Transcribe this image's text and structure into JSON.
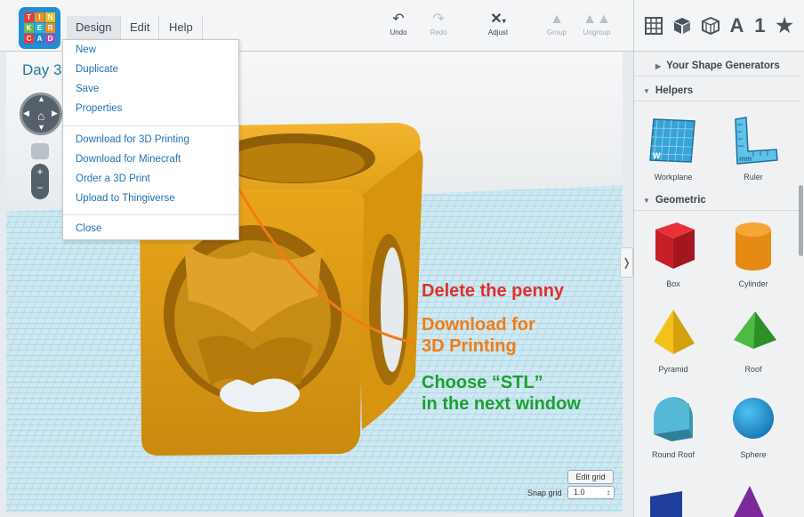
{
  "app": {
    "logo_letters": [
      "T",
      "I",
      "N",
      "K",
      "E",
      "R",
      "C",
      "A",
      "D"
    ],
    "menus": [
      "Design",
      "Edit",
      "Help"
    ],
    "project_title": "Day 3"
  },
  "toolbar": {
    "undo": "Undo",
    "redo": "Redo",
    "adjust": "Adjust",
    "group": "Group",
    "ungroup": "Ungroup",
    "view_icons": [
      "grid-view-icon",
      "box-view-icon",
      "wireframe-icon",
      "text-icon",
      "number-icon",
      "star-icon"
    ],
    "text_icon_label": "A",
    "number_icon_label": "1"
  },
  "dropdown": {
    "items": [
      "New",
      "Duplicate",
      "Save",
      "Properties",
      "Download for 3D Printing",
      "Download for Minecraft",
      "Order a 3D Print",
      "Upload to Thingiverse",
      "Close"
    ]
  },
  "annotations": {
    "line1": "Delete the penny",
    "line2a": "Download for",
    "line2b": "3D Printing",
    "line3a": "Choose “STL”",
    "line3b": "in the next window"
  },
  "grid_controls": {
    "edit_grid": "Edit grid",
    "snap_grid_label": "Snap grid",
    "snap_grid_value": "1.0"
  },
  "sidebar": {
    "shape_generators": "Your Shape Generators",
    "helpers": "Helpers",
    "geometric": "Geometric",
    "helper_items": [
      "Workplane",
      "Ruler"
    ],
    "shapes": [
      "Box",
      "Cylinder",
      "Pyramid",
      "Roof",
      "Round Roof",
      "Sphere"
    ]
  },
  "colors": {
    "accent": "#1b72b5",
    "object": "#e6a21a",
    "annotation_red": "#e0302b",
    "annotation_orange": "#f07c17",
    "annotation_green": "#1aa12f"
  }
}
